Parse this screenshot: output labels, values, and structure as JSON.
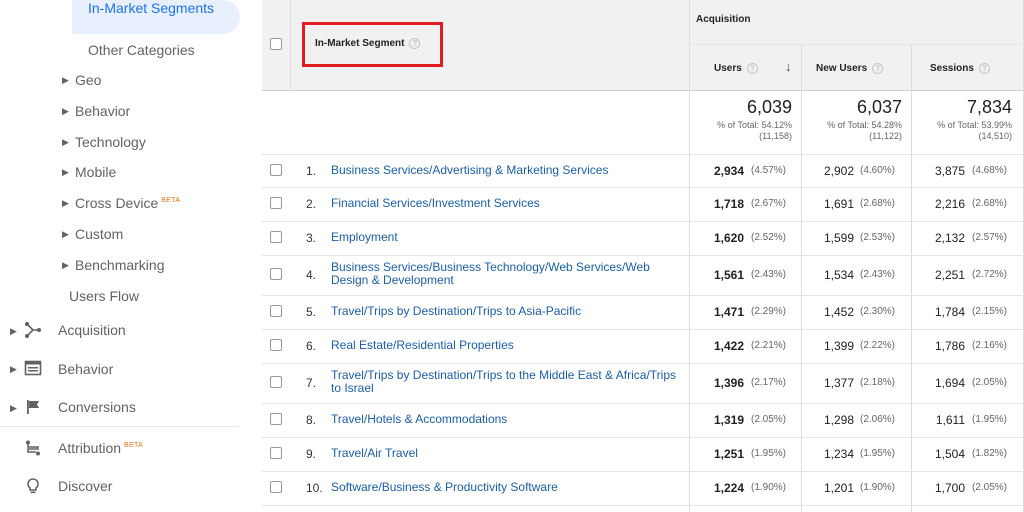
{
  "sidebar": {
    "active": "In-Market Segments",
    "items": [
      {
        "label": "Other Categories"
      },
      {
        "label": "Geo"
      },
      {
        "label": "Behavior"
      },
      {
        "label": "Technology"
      },
      {
        "label": "Mobile"
      },
      {
        "label": "Cross Device",
        "badge": "BETA"
      },
      {
        "label": "Custom"
      },
      {
        "label": "Benchmarking"
      },
      {
        "label": "Users Flow"
      }
    ],
    "sections": [
      {
        "label": "Acquisition",
        "icon": "acquisition-icon"
      },
      {
        "label": "Behavior",
        "icon": "behavior-icon"
      },
      {
        "label": "Conversions",
        "icon": "flag-icon"
      },
      {
        "label": "Attribution",
        "badge": "BETA",
        "icon": "attribution-icon"
      },
      {
        "label": "Discover",
        "icon": "lightbulb-icon"
      }
    ]
  },
  "table": {
    "dimension_header": "In-Market Segment",
    "group_header": "Acquisition",
    "columns": [
      "Users",
      "New Users",
      "Sessions"
    ],
    "totals": [
      {
        "value": "6,039",
        "pct": "% of Total: 54.12%",
        "of": "(11,158)"
      },
      {
        "value": "6,037",
        "pct": "% of Total: 54.28%",
        "of": "(11,122)"
      },
      {
        "value": "7,834",
        "pct": "% of Total: 53.99%",
        "of": "(14,510)"
      }
    ],
    "rows": [
      {
        "rank": "1.",
        "segment": "Business Services/Advertising & Marketing Services",
        "users": "2,934",
        "users_pct": "(4.57%)",
        "new_users": "2,902",
        "new_users_pct": "(4.60%)",
        "sessions": "3,875",
        "sessions_pct": "(4.68%)"
      },
      {
        "rank": "2.",
        "segment": "Financial Services/Investment Services",
        "users": "1,718",
        "users_pct": "(2.67%)",
        "new_users": "1,691",
        "new_users_pct": "(2.68%)",
        "sessions": "2,216",
        "sessions_pct": "(2.68%)"
      },
      {
        "rank": "3.",
        "segment": "Employment",
        "users": "1,620",
        "users_pct": "(2.52%)",
        "new_users": "1,599",
        "new_users_pct": "(2.53%)",
        "sessions": "2,132",
        "sessions_pct": "(2.57%)"
      },
      {
        "rank": "4.",
        "segment": "Business Services/Business Technology/Web Services/Web Design & Development",
        "users": "1,561",
        "users_pct": "(2.43%)",
        "new_users": "1,534",
        "new_users_pct": "(2.43%)",
        "sessions": "2,251",
        "sessions_pct": "(2.72%)"
      },
      {
        "rank": "5.",
        "segment": "Travel/Trips by Destination/Trips to Asia-Pacific",
        "users": "1,471",
        "users_pct": "(2.29%)",
        "new_users": "1,452",
        "new_users_pct": "(2.30%)",
        "sessions": "1,784",
        "sessions_pct": "(2.15%)"
      },
      {
        "rank": "6.",
        "segment": "Real Estate/Residential Properties",
        "users": "1,422",
        "users_pct": "(2.21%)",
        "new_users": "1,399",
        "new_users_pct": "(2.22%)",
        "sessions": "1,786",
        "sessions_pct": "(2.16%)"
      },
      {
        "rank": "7.",
        "segment": "Travel/Trips by Destination/Trips to the Middle East & Africa/Trips to Israel",
        "users": "1,396",
        "users_pct": "(2.17%)",
        "new_users": "1,377",
        "new_users_pct": "(2.18%)",
        "sessions": "1,694",
        "sessions_pct": "(2.05%)"
      },
      {
        "rank": "8.",
        "segment": "Travel/Hotels & Accommodations",
        "users": "1,319",
        "users_pct": "(2.05%)",
        "new_users": "1,298",
        "new_users_pct": "(2.06%)",
        "sessions": "1,611",
        "sessions_pct": "(1.95%)"
      },
      {
        "rank": "9.",
        "segment": "Travel/Air Travel",
        "users": "1,251",
        "users_pct": "(1.95%)",
        "new_users": "1,234",
        "new_users_pct": "(1.95%)",
        "sessions": "1,504",
        "sessions_pct": "(1.82%)"
      },
      {
        "rank": "10.",
        "segment": "Software/Business & Productivity Software",
        "users": "1,224",
        "users_pct": "(1.90%)",
        "new_users": "1,201",
        "new_users_pct": "(1.90%)",
        "sessions": "1,700",
        "sessions_pct": "(2.05%)"
      }
    ]
  },
  "colors": {
    "link": "#1a5fa8",
    "active_bg": "#e8f0fe",
    "active_text": "#1a73e8",
    "highlight_box": "#e31b23",
    "beta": "#e8710a"
  }
}
